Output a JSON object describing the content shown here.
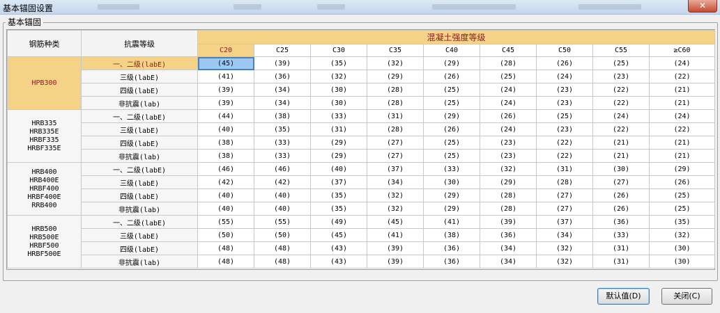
{
  "window": {
    "title": "基本锚固设置",
    "close_glyph": "✕"
  },
  "group": {
    "label": "基本锚固"
  },
  "table": {
    "steel_header": "钢筋种类",
    "seismic_header": "抗震等级",
    "concrete_header": "混凝土强度等级",
    "grades": [
      "C20",
      "C25",
      "C30",
      "C35",
      "C40",
      "C45",
      "C50",
      "C55",
      "≥C60"
    ],
    "groups": [
      {
        "steel_lines": [
          "HPB300"
        ],
        "rows": [
          {
            "seismic": "一、二级(labE)",
            "values": [
              "(45)",
              "(39)",
              "(35)",
              "(32)",
              "(29)",
              "(28)",
              "(26)",
              "(25)",
              "(24)"
            ]
          },
          {
            "seismic": "三级(labE)",
            "values": [
              "(41)",
              "(36)",
              "(32)",
              "(29)",
              "(26)",
              "(25)",
              "(24)",
              "(23)",
              "(22)"
            ]
          },
          {
            "seismic": "四级(labE)",
            "values": [
              "(39)",
              "(34)",
              "(30)",
              "(28)",
              "(25)",
              "(24)",
              "(23)",
              "(22)",
              "(21)"
            ]
          },
          {
            "seismic": "非抗震(lab)",
            "values": [
              "(39)",
              "(34)",
              "(30)",
              "(28)",
              "(25)",
              "(24)",
              "(23)",
              "(22)",
              "(21)"
            ]
          }
        ]
      },
      {
        "steel_lines": [
          "HRB335",
          "HRB335E",
          "HRBF335",
          "HRBF335E"
        ],
        "rows": [
          {
            "seismic": "一、二级(labE)",
            "values": [
              "(44)",
              "(38)",
              "(33)",
              "(31)",
              "(29)",
              "(26)",
              "(25)",
              "(24)",
              "(24)"
            ]
          },
          {
            "seismic": "三级(labE)",
            "values": [
              "(40)",
              "(35)",
              "(31)",
              "(28)",
              "(26)",
              "(24)",
              "(23)",
              "(22)",
              "(22)"
            ]
          },
          {
            "seismic": "四级(labE)",
            "values": [
              "(38)",
              "(33)",
              "(29)",
              "(27)",
              "(25)",
              "(23)",
              "(22)",
              "(21)",
              "(21)"
            ]
          },
          {
            "seismic": "非抗震(lab)",
            "values": [
              "(38)",
              "(33)",
              "(29)",
              "(27)",
              "(25)",
              "(23)",
              "(22)",
              "(21)",
              "(21)"
            ]
          }
        ]
      },
      {
        "steel_lines": [
          "HRB400",
          "HRB400E",
          "HRBF400",
          "HRBF400E",
          "RRB400"
        ],
        "rows": [
          {
            "seismic": "一、二级(labE)",
            "values": [
              "(46)",
              "(46)",
              "(40)",
              "(37)",
              "(33)",
              "(32)",
              "(31)",
              "(30)",
              "(29)"
            ]
          },
          {
            "seismic": "三级(labE)",
            "values": [
              "(42)",
              "(42)",
              "(37)",
              "(34)",
              "(30)",
              "(29)",
              "(28)",
              "(27)",
              "(26)"
            ]
          },
          {
            "seismic": "四级(labE)",
            "values": [
              "(40)",
              "(40)",
              "(35)",
              "(32)",
              "(29)",
              "(28)",
              "(27)",
              "(26)",
              "(25)"
            ]
          },
          {
            "seismic": "非抗震(lab)",
            "values": [
              "(40)",
              "(40)",
              "(35)",
              "(32)",
              "(29)",
              "(28)",
              "(27)",
              "(26)",
              "(25)"
            ]
          }
        ]
      },
      {
        "steel_lines": [
          "HRB500",
          "HRB500E",
          "HRBF500",
          "HRBF500E"
        ],
        "rows": [
          {
            "seismic": "一、二级(labE)",
            "values": [
              "(55)",
              "(55)",
              "(49)",
              "(45)",
              "(41)",
              "(39)",
              "(37)",
              "(36)",
              "(35)"
            ]
          },
          {
            "seismic": "三级(labE)",
            "values": [
              "(50)",
              "(50)",
              "(45)",
              "(41)",
              "(38)",
              "(36)",
              "(34)",
              "(33)",
              "(32)"
            ]
          },
          {
            "seismic": "四级(labE)",
            "values": [
              "(48)",
              "(48)",
              "(43)",
              "(39)",
              "(36)",
              "(34)",
              "(32)",
              "(31)",
              "(30)"
            ]
          },
          {
            "seismic": "非抗震(lab)",
            "values": [
              "(48)",
              "(48)",
              "(43)",
              "(39)",
              "(36)",
              "(34)",
              "(32)",
              "(31)",
              "(30)"
            ]
          }
        ]
      }
    ],
    "selected": {
      "group": 0,
      "row": 0,
      "col": 0
    }
  },
  "buttons": {
    "default_label": "默认值(D)",
    "close_label": "关闭(C)"
  },
  "colors": {
    "header_accent": "#f4d389",
    "header_text": "#8a1a1a",
    "selection": "#9dc8f2"
  }
}
